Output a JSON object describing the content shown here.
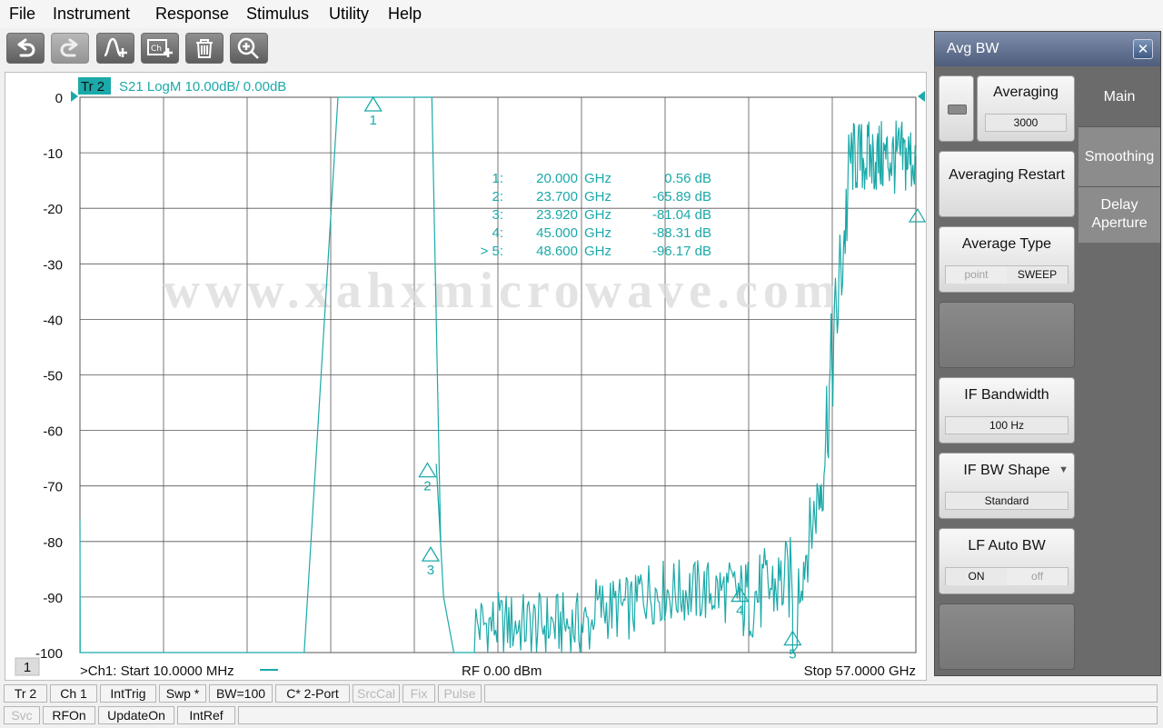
{
  "menu": [
    "File",
    "Instrument",
    "Response",
    "Stimulus",
    "Utility",
    "Help"
  ],
  "toolbar": {
    "buttons": [
      {
        "icon": "undo-icon",
        "enabled": true
      },
      {
        "icon": "redo-icon",
        "enabled": false
      },
      {
        "icon": "add-marker-icon",
        "enabled": true
      },
      {
        "icon": "add-channel-icon",
        "enabled": true
      },
      {
        "icon": "trash-icon",
        "enabled": true
      },
      {
        "icon": "zoom-icon",
        "enabled": true
      }
    ]
  },
  "trace": {
    "id": "Tr 2",
    "info": "S21 LogM 10.00dB/  0.00dB",
    "color": "#1ca9a9"
  },
  "axis": {
    "y_labels": [
      "0",
      "-10",
      "-20",
      "-30",
      "-40",
      "-50",
      "-60",
      "-70",
      "-80",
      "-90",
      "-100"
    ],
    "y_min": -100,
    "y_max": 0,
    "x_start_ghz": 0.01,
    "x_stop_ghz": 57.0
  },
  "markers": [
    {
      "prefix": "",
      "num": "1:",
      "freq": "20.000",
      "unit": "GHz",
      "value": "0.56 dB"
    },
    {
      "prefix": "",
      "num": "2:",
      "freq": "23.700",
      "unit": "GHz",
      "value": "-65.89 dB"
    },
    {
      "prefix": "",
      "num": "3:",
      "freq": "23.920",
      "unit": "GHz",
      "value": "-81.04 dB"
    },
    {
      "prefix": "",
      "num": "4:",
      "freq": "45.000",
      "unit": "GHz",
      "value": "-88.31 dB"
    },
    {
      "prefix": ">",
      "num": "5:",
      "freq": "48.600",
      "unit": "GHz",
      "value": "-96.17 dB"
    }
  ],
  "marker_labels": [
    "1",
    "2",
    "3",
    "4",
    "5"
  ],
  "watermark": "www.xahxmicrowave.com",
  "footer": {
    "channel_num": "1",
    "start": ">Ch1:  Start   10.0000 MHz",
    "rf": "RF     0.00 dBm",
    "stop": "Stop  57.0000 GHz"
  },
  "panel": {
    "title": "Avg BW",
    "tabs": [
      "Main",
      "Smoothing",
      "Delay Aperture"
    ],
    "averaging_label": "Averaging",
    "averaging_value": "3000",
    "restart_label": "Averaging Restart",
    "avg_type_label": "Average Type",
    "avg_type_options": [
      "point",
      "SWEEP"
    ],
    "if_bw_label": "IF Bandwidth",
    "if_bw_value": "100 Hz",
    "if_shape_label": "IF BW Shape",
    "if_shape_value": "Standard",
    "lf_auto_label": "LF Auto BW",
    "lf_auto_options": [
      "ON",
      "off"
    ]
  },
  "status_row1": [
    "Tr 2",
    "Ch 1",
    "IntTrig",
    "Swp *",
    "BW=100",
    "C* 2-Port",
    "SrcCal",
    "Fix",
    "Pulse"
  ],
  "status_row1_dim": [
    false,
    false,
    false,
    false,
    false,
    false,
    true,
    true,
    true
  ],
  "status_row2": [
    "Svc",
    "RFOn",
    "UpdateOn",
    "IntRef"
  ],
  "status_row2_dim": [
    true,
    false,
    false,
    false
  ]
}
